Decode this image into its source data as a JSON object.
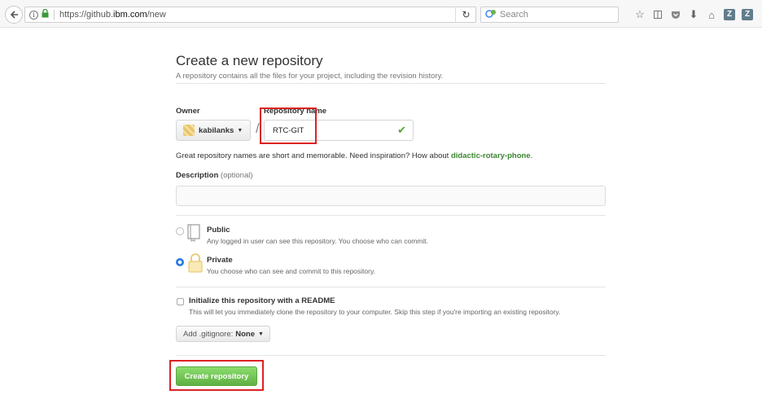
{
  "browser": {
    "url_prefix": "https://github.",
    "url_domain": "ibm.com",
    "url_path": "/new",
    "search_placeholder": "Search",
    "profile_icon_letter": "Z"
  },
  "form": {
    "title": "Create a new repository",
    "subtitle": "A repository contains all the files for your project, including the revision history.",
    "owner_label": "Owner",
    "owner_value": "kabilanks",
    "repo_name_label": "Repository name",
    "repo_name_value": "RTC-GIT",
    "name_hint": "Great repository names are short and memorable. Need inspiration? How about ",
    "name_suggestion": "didactic-rotary-phone",
    "name_hint_end": ".",
    "description_label": "Description",
    "description_optional": "(optional)",
    "public_title": "Public",
    "public_desc": "Any logged in user can see this repository. You choose who can commit.",
    "private_title": "Private",
    "private_desc": "You choose who can see and commit to this repository.",
    "visibility_selected": "Private",
    "readme_title": "Initialize this repository with a README",
    "readme_desc": "This will let you immediately clone the repository to your computer. Skip this step if you're importing an existing repository.",
    "gitignore_prefix": "Add .gitignore:",
    "gitignore_value": "None",
    "create_button": "Create repository"
  },
  "colors": {
    "create_button": "#60b044",
    "suggestion_link": "#3b8630",
    "radio_selected": "#2a7ae2",
    "highlight_box": "#dd2222"
  }
}
